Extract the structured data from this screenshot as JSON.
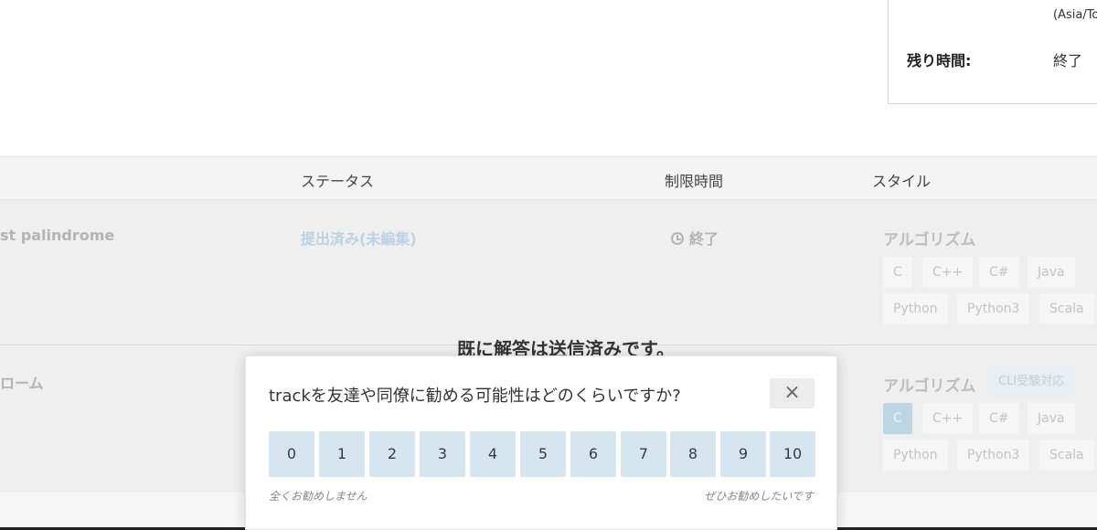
{
  "info_panel": {
    "timezone": "(Asia/To",
    "remaining_label": "残り時間:",
    "remaining_value": "終了"
  },
  "table": {
    "headers": [
      "ステータス",
      "制限時間",
      "スタイル"
    ],
    "rows": [
      {
        "title": "st palindrome",
        "status": "提出済み(未編集)",
        "time_limit": "終了",
        "style_title": "アルゴリズム",
        "languages": [
          "C",
          "C++",
          "C#",
          "Java",
          "Python",
          "Python3",
          "Scala"
        ]
      },
      {
        "title": "ローム",
        "style_title": "アルゴリズム",
        "cli_badge": "CLI受験対応",
        "languages": [
          "C",
          "C++",
          "C#",
          "Java",
          "Python",
          "Python3",
          "Scala"
        ]
      }
    ]
  },
  "overlay": {
    "submitted_message": "既に解答は送信済みです。"
  },
  "survey": {
    "question": "trackを友達や同僚に勧める可能性はどのくらいですか?",
    "close_glyph": "×",
    "scores": [
      "0",
      "1",
      "2",
      "3",
      "4",
      "5",
      "6",
      "7",
      "8",
      "9",
      "10"
    ],
    "low_label": "全くお勧めしません",
    "high_label": "ぜひお勧めしたいです"
  },
  "colors": {
    "score_button_bg": "#d5e6f1",
    "status_link": "#b9d3e3",
    "active_chip": "#bcd6e6"
  }
}
